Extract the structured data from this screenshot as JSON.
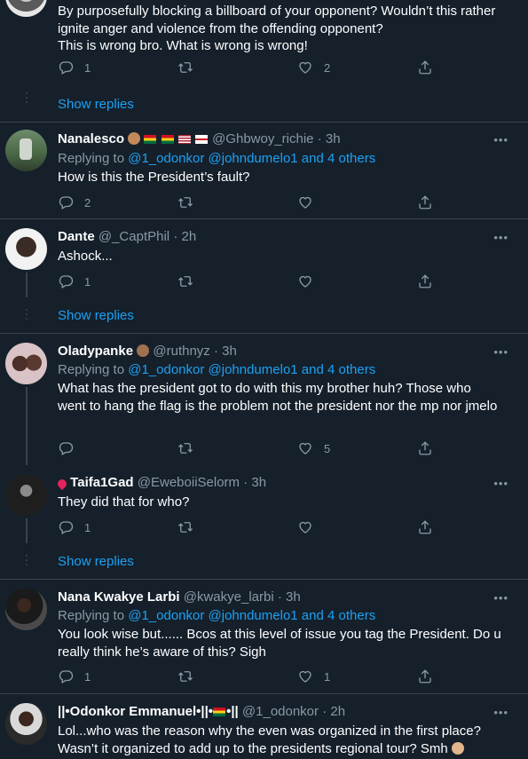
{
  "tweets": [
    {
      "text": "By purposefully blocking a billboard of your opponent? Wouldn’t this rather ignite anger and violence from the offending opponent?\nThis is wrong bro. What is wrong is wrong!",
      "replies": "1",
      "likes": "2"
    },
    {
      "name": "Nanalesco",
      "handle": "@Ghbwoy_richie",
      "time": "3h",
      "replying": "Replying to",
      "mentions": "@1_odonkor @johndumelo1 and 4 others",
      "text": "How is this the President’s fault?",
      "replies": "2",
      "likes": ""
    },
    {
      "name": "Dante",
      "handle": "@_CaptPhil",
      "time": "2h",
      "text": "Ashock...",
      "replies": "1",
      "likes": ""
    },
    {
      "name": "Oladypanke",
      "handle": "@ruthnyz",
      "time": "3h",
      "replying": "Replying to",
      "mentions": "@1_odonkor @johndumelo1 and 4 others",
      "text": "What has the president got to do with this my brother huh? Those who went to hang the flag is the problem not the president nor the mp nor jmelo",
      "replies": "",
      "likes": "5"
    },
    {
      "name": "Taifa1Gad",
      "handle": "@EweboiiSelorm",
      "time": "3h",
      "text": "They did that for who?",
      "replies": "1",
      "likes": ""
    },
    {
      "name": "Nana Kwakye Larbi",
      "handle": "@kwakye_larbi",
      "time": "3h",
      "replying": "Replying to",
      "mentions": "@1_odonkor @johndumelo1 and 4 others",
      "text": "You look wise but......  Bcos at this level of issue you tag the President. Do u really think he’s aware of this? Sigh",
      "replies": "1",
      "likes": "1"
    },
    {
      "name": "||•Odonkor Emmanuel•||•",
      "name_suffix": "•||",
      "handle": "@1_odonkor",
      "time": "2h",
      "text": "Lol...who was the reason why the even was organized in the first place? Wasn’t it organized to add up to the presidents regional tour? Smh"
    }
  ],
  "show_replies": "Show replies",
  "time_sep": "·",
  "more_glyph": "•••",
  "icons": [
    "reply-icon",
    "retweet-icon",
    "like-icon",
    "share-icon",
    "more-icon",
    "location-pin-icon",
    "flag-ghana-icon",
    "flag-usa-icon",
    "flag-england-icon"
  ],
  "colors": {
    "background": "#15202b",
    "accent": "#1da1f2",
    "muted": "#8899a6",
    "border": "#38444d"
  }
}
